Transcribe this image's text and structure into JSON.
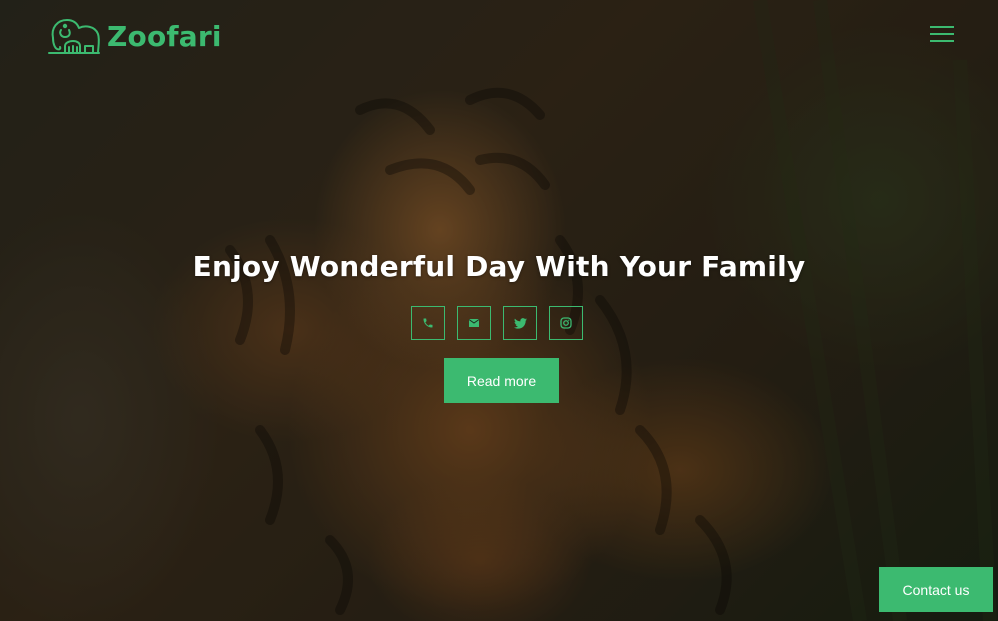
{
  "brand": {
    "name": "Zoofari",
    "logo_icon": "elephant-icon",
    "accent_color": "#3cba70"
  },
  "header": {
    "menu_icon": "hamburger-menu-icon"
  },
  "hero": {
    "title": "Enjoy Wonderful Day With Your Family",
    "social_links": [
      {
        "icon": "phone-icon"
      },
      {
        "icon": "envelope-icon"
      },
      {
        "icon": "twitter-icon"
      },
      {
        "icon": "instagram-icon"
      }
    ],
    "read_more_label": "Read more"
  },
  "floating": {
    "contact_label": "Contact us"
  }
}
